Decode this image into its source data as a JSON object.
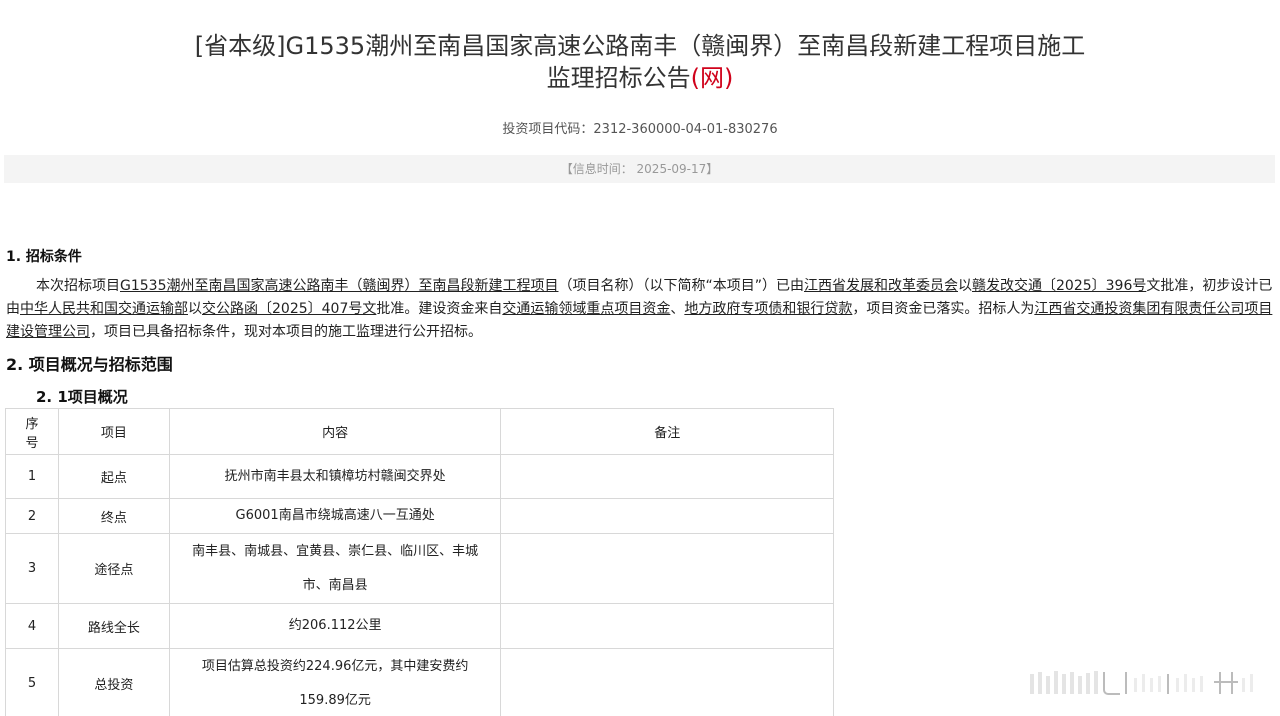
{
  "title": {
    "line1": "[省本级]G1535潮州至南昌国家高速公路南丰（赣闽界）至南昌段新建工程项目施工",
    "line2_main": "监理招标公告",
    "line2_suffix": "(网)"
  },
  "project_code": "投资项目代码：2312-360000-04-01-830276",
  "info_time": "【信息时间：  2025-09-17】",
  "section1": {
    "heading": "1. 招标条件",
    "paragraph": [
      {
        "text": "本次招标项目",
        "u": false
      },
      {
        "text": "G1535潮州至南昌国家高速公路南丰（赣闽界）至南昌段新建工程项目",
        "u": true
      },
      {
        "text": "（项目名称）（以下简称“本项目”）已由",
        "u": false
      },
      {
        "text": "江西省发展和改革委员会",
        "u": true
      },
      {
        "text": "以",
        "u": false
      },
      {
        "text": "赣发改交通〔2025〕396号",
        "u": true
      },
      {
        "text": "文批准，初步设计已由",
        "u": false
      },
      {
        "text": "中华人民共和国交通运输部",
        "u": true
      },
      {
        "text": "以",
        "u": false
      },
      {
        "text": "交公路函〔2025〕407号文",
        "u": true
      },
      {
        "text": "批准。建设资金来自",
        "u": false
      },
      {
        "text": "交通运输领域重点项目资金",
        "u": true
      },
      {
        "text": "、",
        "u": false
      },
      {
        "text": "地方政府专项债和银行贷款",
        "u": true
      },
      {
        "text": "，项目资金已落实。招标人为",
        "u": false
      },
      {
        "text": "江西省交通投资集团有限责任公司项目建设管理公司",
        "u": true
      },
      {
        "text": "，项目已具备招标条件，现对本项目的施工监理进行公开招标。",
        "u": false
      }
    ]
  },
  "section2": {
    "heading": "2. 项目概况与招标范围",
    "sub_heading": "2. 1项目概况",
    "table": {
      "headers": [
        "序号",
        "项目",
        "内容",
        "备注"
      ],
      "rows": [
        {
          "no": "1",
          "item": "起点",
          "content": "抚州市南丰县太和镇樟坊村赣闽交界处",
          "note": ""
        },
        {
          "no": "2",
          "item": "终点",
          "content": "G6001南昌市绕城高速八一互通处",
          "note": ""
        },
        {
          "no": "3",
          "item": "途径点",
          "content": "南丰县、南城县、宜黄县、崇仁县、临川区、丰城市、南昌县",
          "note": ""
        },
        {
          "no": "4",
          "item": "路线全长",
          "content": "约206.112公里",
          "note": ""
        },
        {
          "no": "5",
          "item": "总投资",
          "content": "项目估算总投资约224.96亿元，其中建安费约159.89亿元",
          "note": ""
        }
      ]
    }
  }
}
